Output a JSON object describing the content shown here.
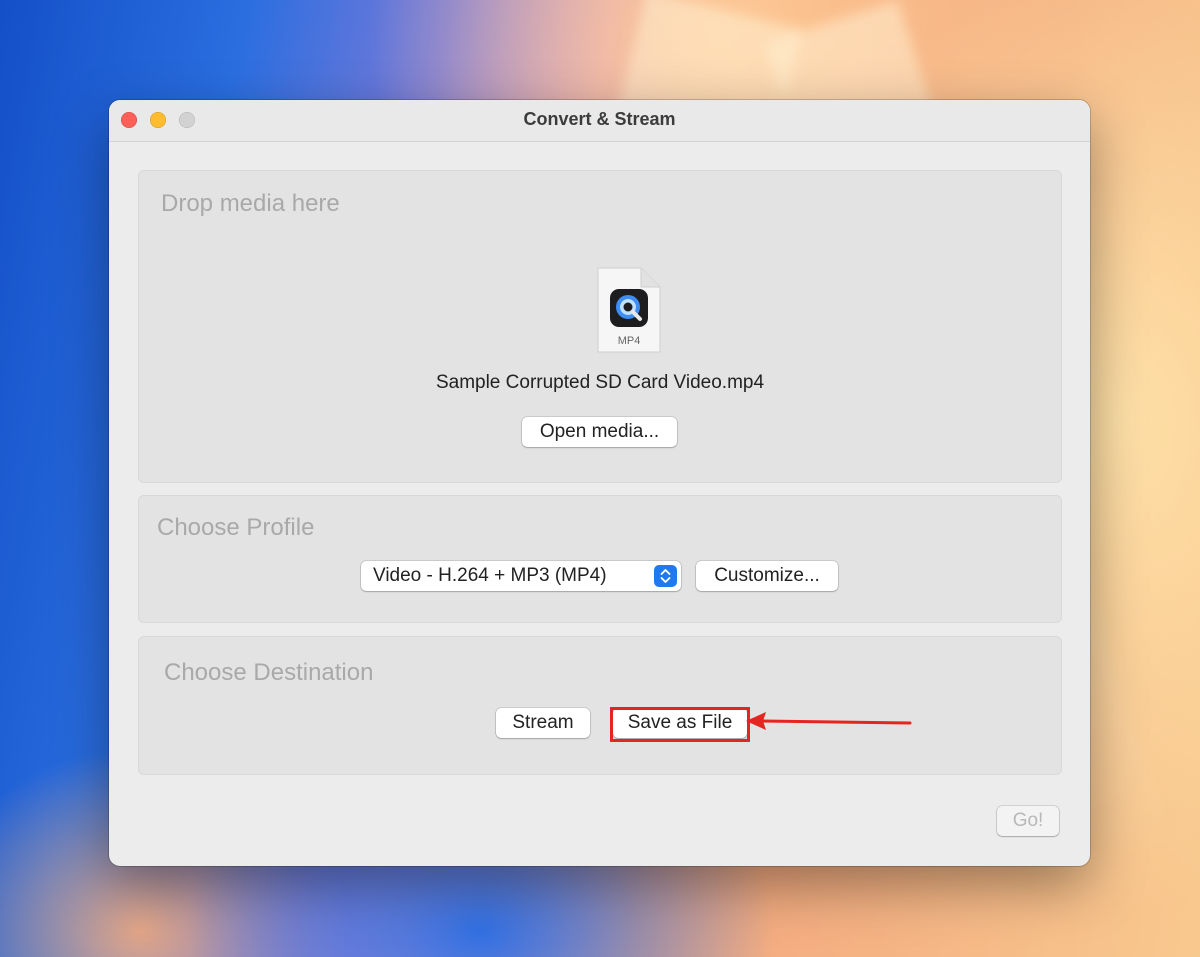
{
  "window": {
    "title": "Convert & Stream"
  },
  "drop_panel": {
    "heading": "Drop media here",
    "file_type_label": "MP4",
    "file_name": "Sample Corrupted SD Card Video.mp4",
    "open_button": "Open media..."
  },
  "profile_panel": {
    "heading": "Choose Profile",
    "selected_profile": "Video - H.264 + MP3 (MP4)",
    "customize_button": "Customize..."
  },
  "destination_panel": {
    "heading": "Choose Destination",
    "stream_button": "Stream",
    "save_button": "Save as File"
  },
  "footer": {
    "go_button": "Go!"
  },
  "annotation": {
    "highlight_color": "#e5251f"
  },
  "colors": {
    "close": "#fe5f57",
    "minimize": "#febc2e",
    "zoom_inactive": "#d2d2d2",
    "select_accent": "#1f7af0"
  }
}
